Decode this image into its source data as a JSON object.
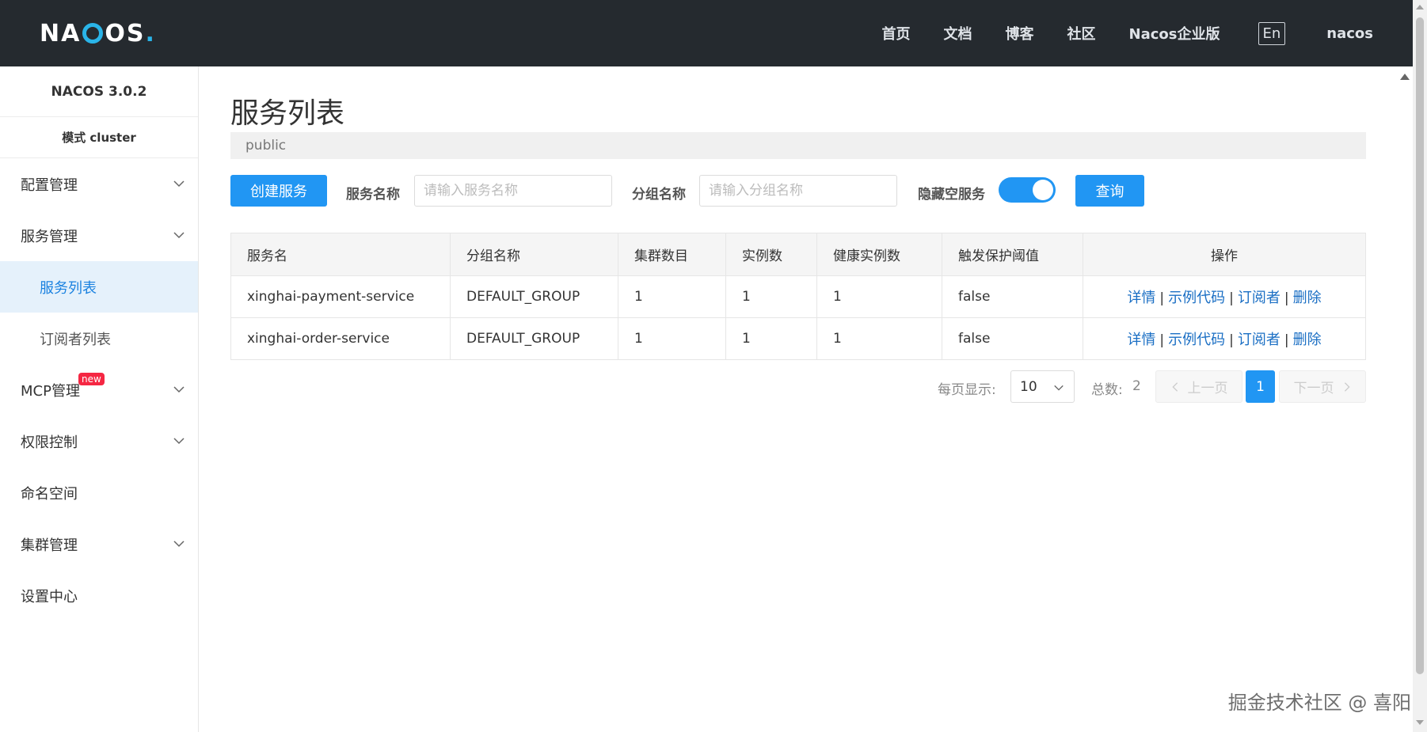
{
  "header": {
    "logo_text": "NACOS.",
    "nav": [
      "首页",
      "文档",
      "博客",
      "社区",
      "Nacos企业版"
    ],
    "lang": "En",
    "user": "nacos"
  },
  "sidebar": {
    "version": "NACOS 3.0.2",
    "mode": "模式 cluster",
    "items": [
      {
        "label": "配置管理",
        "expandable": true
      },
      {
        "label": "服务管理",
        "expandable": true
      },
      {
        "label": "服务列表",
        "sub": true,
        "active": true
      },
      {
        "label": "订阅者列表",
        "sub": true
      },
      {
        "label": "MCP管理",
        "expandable": true,
        "badge": "new"
      },
      {
        "label": "权限控制",
        "expandable": true
      },
      {
        "label": "命名空间"
      },
      {
        "label": "集群管理",
        "expandable": true
      },
      {
        "label": "设置中心"
      }
    ]
  },
  "main": {
    "title": "服务列表",
    "namespace": "public",
    "toolbar": {
      "create_label": "创建服务",
      "service_name_label": "服务名称",
      "service_name_placeholder": "请输入服务名称",
      "group_name_label": "分组名称",
      "group_name_placeholder": "请输入分组名称",
      "hide_empty_label": "隐藏空服务",
      "hide_empty_on": true,
      "query_label": "查询"
    },
    "table": {
      "headers": [
        "服务名",
        "分组名称",
        "集群数目",
        "实例数",
        "健康实例数",
        "触发保护阈值",
        "操作"
      ],
      "rows": [
        {
          "name": "xinghai-payment-service",
          "group": "DEFAULT_GROUP",
          "clusters": "1",
          "instances": "1",
          "healthy": "1",
          "protect": "false"
        },
        {
          "name": "xinghai-order-service",
          "group": "DEFAULT_GROUP",
          "clusters": "1",
          "instances": "1",
          "healthy": "1",
          "protect": "false"
        }
      ],
      "actions": [
        "详情",
        "示例代码",
        "订阅者",
        "删除"
      ]
    },
    "pagination": {
      "page_size_label": "每页显示:",
      "page_size": "10",
      "total_label": "总数:",
      "total": "2",
      "prev_label": "上一页",
      "current_page": "1",
      "next_label": "下一页"
    }
  },
  "watermark": "掘金技术社区 @ 喜阳",
  "colors": {
    "header_bg": "#252a2f",
    "accent": "#2196f3",
    "link": "#1b6fc4",
    "logo_accent": "#2ab4e8",
    "badge": "#f52743"
  }
}
